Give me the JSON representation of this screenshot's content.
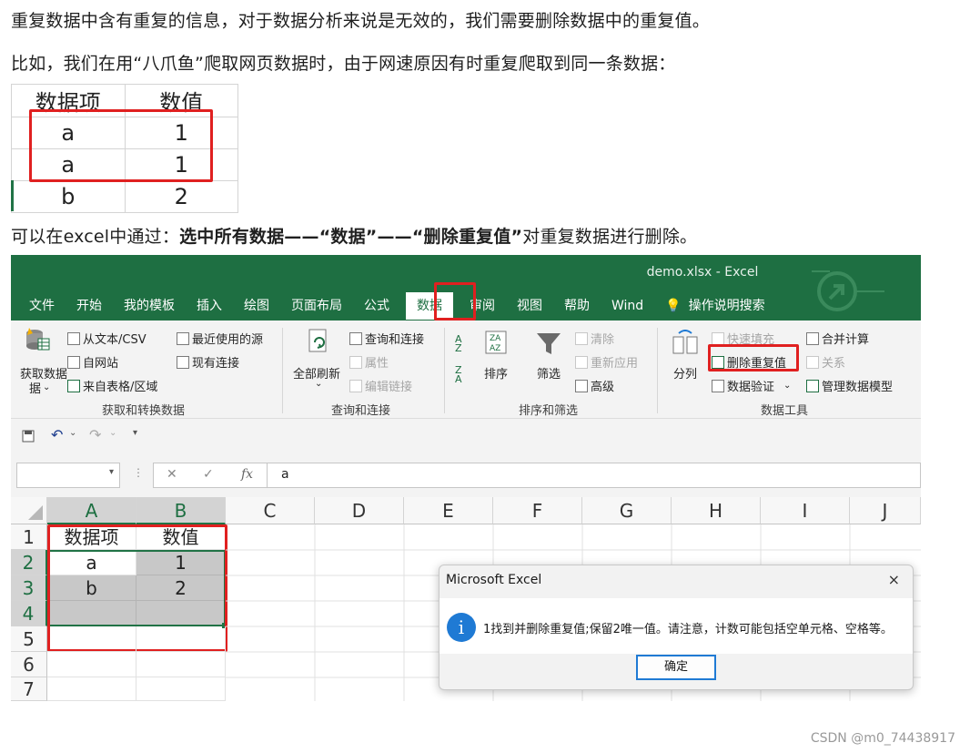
{
  "para1": "重复数据中含有重复的信息，对于数据分析来说是无效的，我们需要删除数据中的重复值。",
  "para2": "比如，我们在用“八爪鱼”爬取网页数据时，由于网速原因有时重复爬取到同一条数据：",
  "mini_table": {
    "headers": [
      "数据项",
      "数值"
    ],
    "rows": [
      [
        "a",
        "1"
      ],
      [
        "a",
        "1"
      ],
      [
        "b",
        "2"
      ]
    ]
  },
  "para3": {
    "prefix": "可以在excel中通过：",
    "bold": "选中所有数据——“数据”——“删除重复值”",
    "suffix": "对重复数据进行删除。"
  },
  "excel": {
    "window_title": "demo.xlsx  -  Excel",
    "tabs": [
      "文件",
      "开始",
      "我的模板",
      "插入",
      "绘图",
      "页面布局",
      "公式",
      "数据",
      "审阅",
      "视图",
      "帮助",
      "Wind",
      "操作说明搜索"
    ],
    "ribbon": {
      "get_data": "获取数据",
      "get_data_2": "据",
      "from_text": "从文本/CSV",
      "from_web": "自网站",
      "from_table": "来自表格/区域",
      "recent_sources": "最近使用的源",
      "existing_conn": "现有连接",
      "group1": "获取和转换数据",
      "refresh_all": "全部刷新",
      "queries_conn": "查询和连接",
      "properties": "属性",
      "edit_links": "编辑链接",
      "group2": "查询和连接",
      "sort": "排序",
      "filter": "筛选",
      "clear": "清除",
      "reapply": "重新应用",
      "advanced": "高级",
      "group3": "排序和筛选",
      "split": "分列",
      "flash_fill": "快速填充",
      "remove_dup": "删除重复值",
      "validation": "数据验证",
      "consolidate": "合并计算",
      "relations": "关系",
      "manage_model": "管理数据模型",
      "group4": "数据工具"
    },
    "formula_value": "a",
    "fx_label": "fx",
    "columns": [
      "A",
      "B",
      "C",
      "D",
      "E",
      "F",
      "G",
      "H",
      "I",
      "J"
    ],
    "row_numbers": [
      "1",
      "2",
      "3",
      "4",
      "5",
      "6",
      "7"
    ],
    "sheet": {
      "header": [
        "数据项",
        "数值"
      ],
      "r2": [
        "a",
        "1"
      ],
      "r3": [
        "b",
        "2"
      ]
    },
    "dialog": {
      "title": "Microsoft Excel",
      "close": "×",
      "icon": "i",
      "message": "1找到并删除重复值;保留2唯一值。请注意，计数可能包括空单元格、空格等。",
      "ok": "确定"
    }
  },
  "watermark": "CSDN @m0_74438917",
  "colors": {
    "excel_green": "#1e6f42",
    "highlight_red": "#e02020",
    "info_blue": "#1f7ad4"
  }
}
